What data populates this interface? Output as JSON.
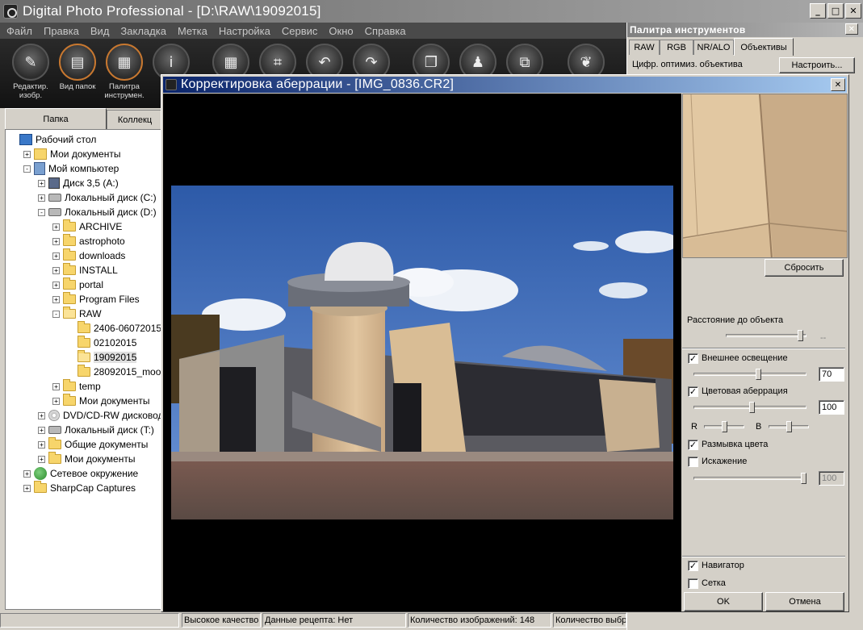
{
  "app": {
    "title": "Digital Photo Professional - [D:\\RAW\\19092015]",
    "menu": [
      "Файл",
      "Правка",
      "Вид",
      "Закладка",
      "Метка",
      "Настройка",
      "Сервис",
      "Окно",
      "Справка"
    ],
    "toolbar": [
      {
        "icon": "edit-image-icon",
        "label": "Редактир. изобр."
      },
      {
        "icon": "folder-view-icon",
        "label": "Вид папок"
      },
      {
        "icon": "tool-palette-icon",
        "label": "Палитра инструмен."
      },
      {
        "icon": "info-icon",
        "label": "Ин"
      },
      {
        "icon": "grid-icon",
        "label": ""
      },
      {
        "icon": "crop-icon",
        "label": ""
      },
      {
        "icon": "rotate-left-icon",
        "label": ""
      },
      {
        "icon": "rotate-right-icon",
        "label": ""
      },
      {
        "icon": "copy-recipe-icon",
        "label": ""
      },
      {
        "icon": "stamp-icon",
        "label": ""
      },
      {
        "icon": "convert-icon",
        "label": ""
      },
      {
        "icon": "dpp-logo-icon",
        "label": ""
      }
    ],
    "left_tabs": [
      "Папка",
      "Коллекц"
    ],
    "tree": [
      {
        "label": "Рабочий стол",
        "level": 0,
        "icon": "desktop",
        "exp": ""
      },
      {
        "label": "Мои документы",
        "level": 1,
        "icon": "docs",
        "exp": "+"
      },
      {
        "label": "Мой компьютер",
        "level": 1,
        "icon": "computer",
        "exp": "-"
      },
      {
        "label": "Диск 3,5 (A:)",
        "level": 2,
        "icon": "floppy",
        "exp": "+"
      },
      {
        "label": "Локальный диск (C:)",
        "level": 2,
        "icon": "drive",
        "exp": "+"
      },
      {
        "label": "Локальный диск (D:)",
        "level": 2,
        "icon": "drive",
        "exp": "-"
      },
      {
        "label": "ARCHIVE",
        "level": 3,
        "icon": "folder",
        "exp": "+"
      },
      {
        "label": "astrophoto",
        "level": 3,
        "icon": "folder",
        "exp": "+"
      },
      {
        "label": "downloads",
        "level": 3,
        "icon": "folder",
        "exp": "+"
      },
      {
        "label": "INSTALL",
        "level": 3,
        "icon": "folder",
        "exp": "+"
      },
      {
        "label": "portal",
        "level": 3,
        "icon": "folder",
        "exp": "+"
      },
      {
        "label": "Program Files",
        "level": 3,
        "icon": "folder",
        "exp": "+"
      },
      {
        "label": "RAW",
        "level": 3,
        "icon": "folder-open",
        "exp": "-"
      },
      {
        "label": "2406-06072015",
        "level": 4,
        "icon": "folder",
        "exp": ""
      },
      {
        "label": "02102015",
        "level": 4,
        "icon": "folder",
        "exp": ""
      },
      {
        "label": "19092015",
        "level": 4,
        "icon": "folder-open",
        "exp": "",
        "selected": true
      },
      {
        "label": "28092015_moon",
        "level": 4,
        "icon": "folder",
        "exp": ""
      },
      {
        "label": "temp",
        "level": 3,
        "icon": "folder",
        "exp": "+"
      },
      {
        "label": "Мои документы",
        "level": 3,
        "icon": "folder",
        "exp": "+"
      },
      {
        "label": "DVD/CD-RW дисковод",
        "level": 2,
        "icon": "cd",
        "exp": "+"
      },
      {
        "label": "Локальный диск (T:)",
        "level": 2,
        "icon": "drive",
        "exp": "+"
      },
      {
        "label": "Общие документы",
        "level": 2,
        "icon": "folder",
        "exp": "+"
      },
      {
        "label": "Мои документы",
        "level": 2,
        "icon": "folder",
        "exp": "+"
      },
      {
        "label": "Сетевое окружение",
        "level": 1,
        "icon": "network",
        "exp": "+"
      },
      {
        "label": "SharpCap Captures",
        "level": 1,
        "icon": "folder",
        "exp": "+"
      }
    ],
    "status": [
      "Высокое качество",
      "Данные рецепта: Нет",
      "Количество изображений: 148",
      "Количество выбр"
    ]
  },
  "palette": {
    "title": "Палитра инструментов",
    "tabs": [
      "RAW",
      "RGB",
      "NR/ALO",
      "Объективы"
    ],
    "active_tab": "Объективы",
    "row_label": "Цифр. оптимиз. объектива",
    "row_button": "Настроить..."
  },
  "dialog": {
    "title": "Корректировка аберрации - [IMG_0836.CR2]",
    "reset_button": "Сбросить",
    "distance_label": "Расстояние до объекта",
    "distance_value": "--",
    "distance_level": 0.96,
    "peripheral": {
      "label": "Внешнее освещение",
      "checked": true,
      "value": "70",
      "level": 0.58
    },
    "chromatic": {
      "label": "Цветовая аберрация",
      "checked": true,
      "value": "100",
      "level": 0.52
    },
    "r_label": "R",
    "b_label": "B",
    "r_level": 0.5,
    "b_level": 0.5,
    "color_blur": {
      "label": "Размывка цвета",
      "checked": true
    },
    "distortion": {
      "label": "Искажение",
      "checked": false,
      "value": "100",
      "level": 1.0
    },
    "navigator": {
      "label": "Навигатор",
      "checked": true
    },
    "grid": {
      "label": "Сетка",
      "checked": false
    },
    "ok_button": "OK",
    "cancel_button": "Отмена",
    "check_glyph": "✓"
  },
  "colors": {
    "dialog_title_start": "#0a246a",
    "dialog_title_end": "#a6caf0",
    "toolbar_bg": "#1a1a1a",
    "sky": "#3a64b4"
  }
}
